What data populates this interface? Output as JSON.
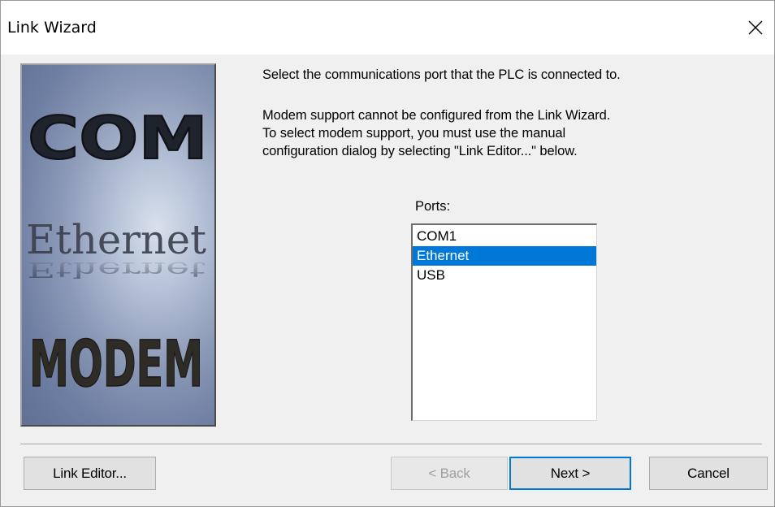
{
  "window": {
    "title": "Link Wizard",
    "close_glyph": "✕"
  },
  "image_panel": {
    "word1": "COM",
    "word2": "Ethernet",
    "word3": "MODEM"
  },
  "instructions": {
    "line1": "Select the communications port that the PLC is connected to.",
    "para2_line1": "Modem support cannot be configured from the Link Wizard.",
    "para2_line2": "To select modem support, you must use the manual",
    "para2_line3": "configuration dialog by selecting \"Link Editor...\" below."
  },
  "ports": {
    "label": "Ports:",
    "items": [
      "COM1",
      "Ethernet",
      "USB"
    ],
    "selected": "Ethernet"
  },
  "buttons": {
    "link_editor": "Link Editor...",
    "back": "< Back",
    "next": "Next >",
    "cancel": "Cancel"
  },
  "colors": {
    "selection": "#0078d7",
    "dialog_bg": "#f0f0f0",
    "panel_blue": "#6f7fa3"
  },
  "icons": {
    "close": "close-icon"
  }
}
